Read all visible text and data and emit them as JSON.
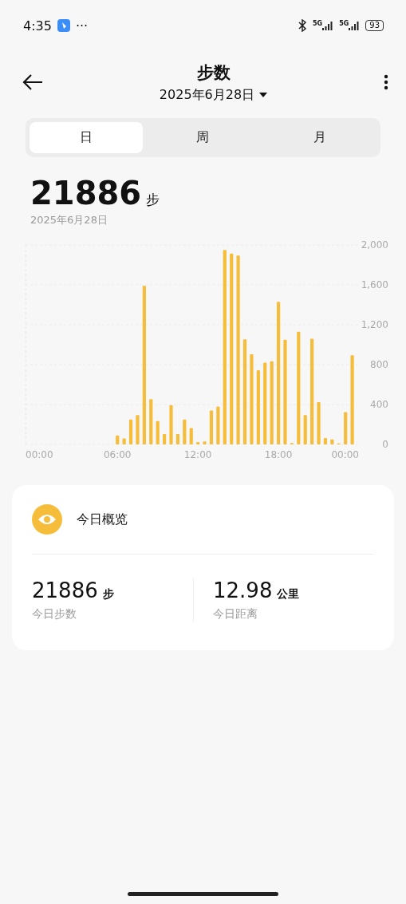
{
  "status_bar": {
    "time": "4:35",
    "more": "···",
    "signals": [
      {
        "label": "5G"
      },
      {
        "label": "5G"
      }
    ],
    "battery": "93"
  },
  "header": {
    "title": "步数",
    "date": "2025年6月28日"
  },
  "tabs": [
    {
      "label": "日",
      "selected": true
    },
    {
      "label": "周",
      "selected": false
    },
    {
      "label": "月",
      "selected": false
    }
  ],
  "summary": {
    "value": "21886",
    "unit": "步",
    "date": "2025年6月28日"
  },
  "chart": {
    "chart_data": {
      "type": "bar",
      "x": [
        0,
        0.5,
        1,
        1.5,
        2,
        2.5,
        3,
        3.5,
        4,
        4.5,
        5,
        5.5,
        6,
        6.5,
        7,
        7.5,
        8,
        8.5,
        9,
        9.5,
        10,
        10.5,
        11,
        11.5,
        12,
        12.5,
        13,
        13.5,
        14,
        14.5,
        15,
        15.5,
        16,
        16.5,
        17,
        17.5,
        18,
        18.5,
        19,
        19.5,
        20,
        20.5,
        21,
        21.5,
        22,
        22.5,
        23,
        23.5
      ],
      "xlim": [
        -0.85,
        24
      ],
      "grid": true,
      "series": [
        {
          "color": "#f5bd3a",
          "values": [
            0,
            0,
            0,
            0,
            0,
            0,
            0,
            0,
            0,
            0,
            0,
            0,
            90,
            60,
            250,
            295,
            1590,
            455,
            235,
            105,
            395,
            105,
            250,
            165,
            25,
            30,
            340,
            380,
            1950,
            1915,
            1895,
            1055,
            905,
            745,
            820,
            835,
            1430,
            1050,
            15,
            1130,
            295,
            1060,
            425,
            65,
            50,
            10,
            325,
            895
          ]
        }
      ],
      "ylim": [
        0,
        2000
      ],
      "yticks": [
        {
          "value": 0,
          "label": "0"
        },
        {
          "value": 400,
          "label": "400"
        },
        {
          "value": 800,
          "label": "800"
        },
        {
          "value": 1200,
          "label": "1,200"
        },
        {
          "value": 1600,
          "label": "1,600"
        },
        {
          "value": 2000,
          "label": "2,000"
        }
      ],
      "xticks": [
        {
          "value": 0,
          "label": "00:00"
        },
        {
          "value": 6,
          "label": "06:00"
        },
        {
          "value": 12,
          "label": "12:00"
        },
        {
          "value": 18,
          "label": "18:00"
        },
        {
          "value": 24,
          "label": "00:00"
        }
      ]
    }
  },
  "overview": {
    "title": "今日概览",
    "stats": [
      {
        "value": "21886",
        "unit": "步",
        "label": "今日步数"
      },
      {
        "value": "12.98",
        "unit": "公里",
        "label": "今日距离"
      }
    ]
  }
}
